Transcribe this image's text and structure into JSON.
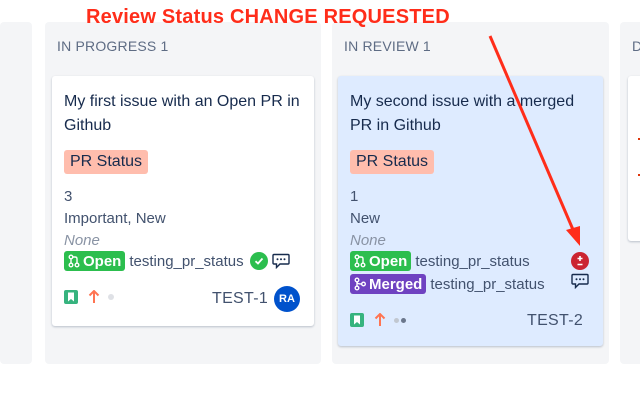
{
  "annotation": {
    "text": "Review Status CHANGE REQUESTED",
    "color": "#ff2d1a"
  },
  "columns": [
    {
      "name": "IN PROGRESS",
      "count": "1"
    },
    {
      "name": "IN REVIEW",
      "count": "1"
    },
    {
      "name": "D",
      "count": ""
    }
  ],
  "cards": [
    {
      "title": "My first issue with an Open PR in Github",
      "lozenge": "PR Status",
      "story_points": "3",
      "labels": "Important, New",
      "component": "None",
      "prs": [
        {
          "state": "Open",
          "repo": "testing_pr_status",
          "review": "approved"
        }
      ],
      "issue_type_icon": "story-icon",
      "priority_icon": "priority-high-arrow-icon",
      "key": "TEST-1",
      "assignee_initials": "RA"
    },
    {
      "title": "My second issue with a merged PR in Github",
      "lozenge": "PR Status",
      "story_points": "1",
      "labels": "New",
      "component": "None",
      "prs": [
        {
          "state": "Open",
          "repo": "testing_pr_status",
          "review": "changes-requested"
        },
        {
          "state": "Merged",
          "repo": "testing_pr_status",
          "review": "commented"
        }
      ],
      "issue_type_icon": "story-icon",
      "priority_icon": "priority-high-arrow-icon",
      "key": "TEST-2"
    }
  ],
  "colors": {
    "pr_open": "#2cbe4e",
    "pr_merged": "#6f42c1",
    "lozenge_bg": "#ffbdad",
    "highlight_card": "#deebff",
    "changes_requested": "#cb2431",
    "avatar": "#0052cc"
  }
}
